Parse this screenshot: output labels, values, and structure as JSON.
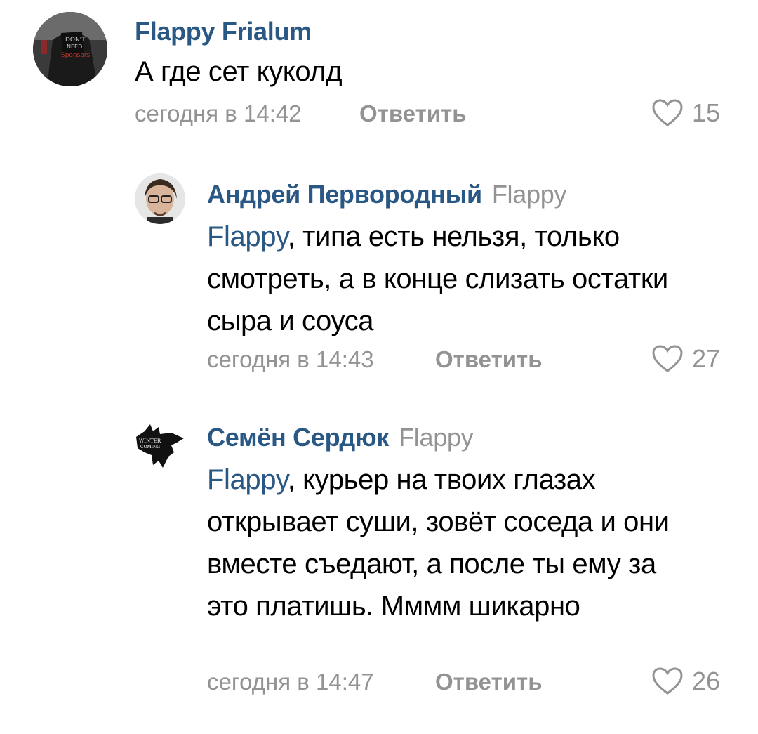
{
  "comments": [
    {
      "author": "Flappy Frialum",
      "reply_to": "",
      "mention": "",
      "text": "А где сет куколд",
      "date": "сегодня в 14:42",
      "reply_label": "Ответить",
      "likes": "15",
      "avatar_icon": "user-photo-avatar"
    },
    {
      "author": "Андрей Первородный",
      "reply_to": "Flappy",
      "mention": "Flappy",
      "text": ", типа есть нельзя, только смотреть, а в конце слизать остатки сыра и соуса",
      "date": "сегодня в 14:43",
      "reply_label": "Ответить",
      "likes": "27",
      "avatar_icon": "user-photo-avatar"
    },
    {
      "author": "Семён Сердюк",
      "reply_to": "Flappy",
      "mention": "Flappy",
      "text": ", курьер на твоих глазах открывает суши, зовёт соседа и они вместе съедают, а после ты ему за это платишь. Мммм шикарно",
      "date": "сегодня в 14:47",
      "reply_label": "Ответить",
      "likes": "26",
      "avatar_icon": "direwolf-avatar"
    }
  ],
  "colors": {
    "link": "#2a5885",
    "secondary": "#939393",
    "text": "#000000"
  }
}
